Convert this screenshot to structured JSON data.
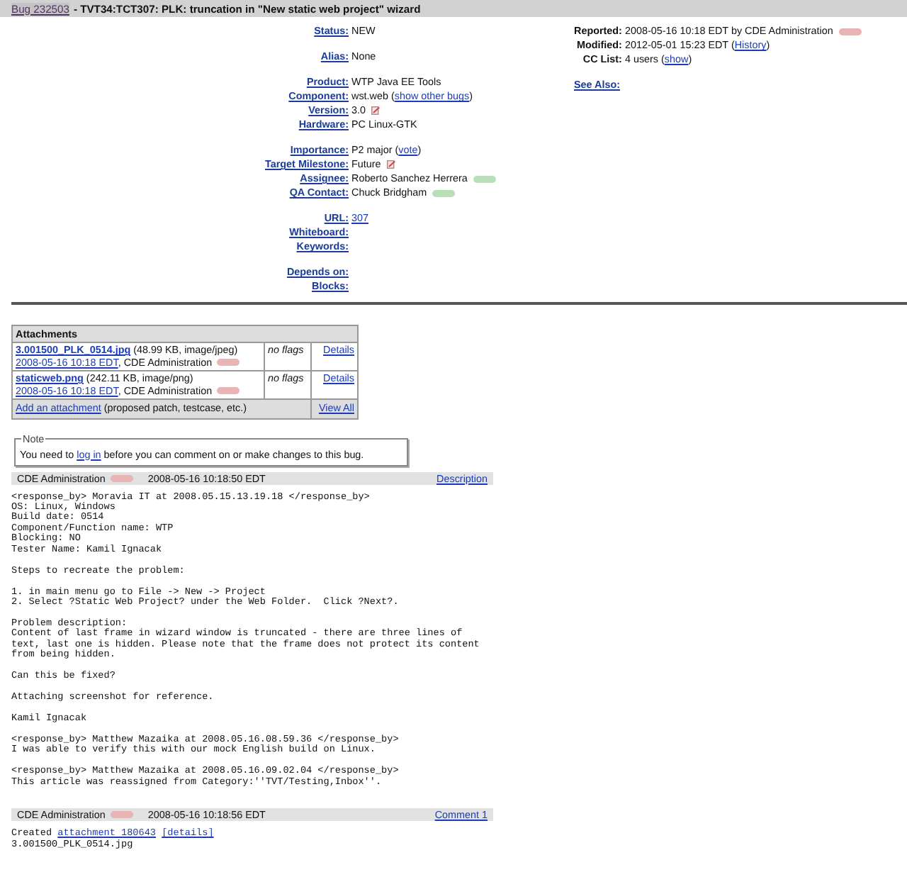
{
  "header": {
    "bug_link": "Bug 232503",
    "title": "- TVT34:TCT307: PLK: truncation in \"New static web project\" wizard"
  },
  "field_groups": [
    [
      {
        "label": "Status:",
        "value": [
          {
            "kind": "text",
            "text": "NEW"
          }
        ]
      }
    ],
    [
      {
        "label": "Alias:",
        "value": [
          {
            "kind": "text",
            "text": "None"
          }
        ]
      }
    ],
    [
      {
        "label": "Product:",
        "value": [
          {
            "kind": "text",
            "text": "WTP Java EE Tools"
          }
        ]
      },
      {
        "label": "Component:",
        "value": [
          {
            "kind": "text",
            "text": "wst.web ("
          },
          {
            "kind": "link",
            "text": "show other bugs"
          },
          {
            "kind": "text",
            "text": ")"
          }
        ]
      },
      {
        "label": "Version:",
        "value": [
          {
            "kind": "text",
            "text": "3.0"
          },
          {
            "kind": "edit"
          }
        ]
      },
      {
        "label": "Hardware:",
        "value": [
          {
            "kind": "text",
            "text": "PC Linux-GTK"
          }
        ]
      }
    ],
    [
      {
        "label": "Importance:",
        "value": [
          {
            "kind": "text",
            "text": "P2 major ("
          },
          {
            "kind": "link",
            "text": "vote"
          },
          {
            "kind": "text",
            "text": ")"
          }
        ]
      },
      {
        "label": "Target Milestone:",
        "value": [
          {
            "kind": "text",
            "text": "Future"
          },
          {
            "kind": "edit"
          }
        ]
      },
      {
        "label": "Assignee:",
        "value": [
          {
            "kind": "text",
            "text": "Roberto Sanchez Herrera"
          },
          {
            "kind": "badge",
            "color": "#b9dfb9"
          }
        ]
      },
      {
        "label": "QA Contact:",
        "value": [
          {
            "kind": "text",
            "text": "Chuck Bridgham"
          },
          {
            "kind": "badge",
            "color": "#b9dfb9"
          }
        ]
      }
    ],
    [
      {
        "label": "URL:",
        "value": [
          {
            "kind": "link",
            "text": "307"
          }
        ]
      },
      {
        "label": "Whiteboard:"
      },
      {
        "label": "Keywords:"
      }
    ],
    [
      {
        "label": "Depends on:"
      },
      {
        "label": "Blocks:"
      }
    ]
  ],
  "people": [
    {
      "label": "Reported:",
      "value": [
        {
          "kind": "text",
          "text": "2008-05-16 10:18 EDT by CDE Administration"
        },
        {
          "kind": "badge",
          "color": "#e8b4b4"
        }
      ]
    },
    {
      "label": "Modified:",
      "value": [
        {
          "kind": "text",
          "text": "2012-05-01 15:23 EDT ("
        },
        {
          "kind": "link",
          "text": "History"
        },
        {
          "kind": "text",
          "text": ")"
        }
      ]
    },
    {
      "label": "CC List:",
      "value": [
        {
          "kind": "text",
          "text": "4 users ("
        },
        {
          "kind": "link",
          "text": "show"
        },
        {
          "kind": "text",
          "text": ")"
        }
      ]
    }
  ],
  "see_also": "See Also:",
  "attachments": {
    "title": "Attachments",
    "rows": [
      {
        "lines": [
          [
            {
              "kind": "file",
              "text": "3.001500_PLK_0514.jpg"
            },
            {
              "kind": "text",
              "text": " (48.99 KB, image/jpeg)"
            }
          ],
          [
            {
              "kind": "link",
              "text": "2008-05-16 10:18 EDT"
            },
            {
              "kind": "text",
              "text": ", CDE Administration"
            },
            {
              "kind": "badge",
              "color": "#e8b4b4"
            }
          ]
        ],
        "flags": "no flags",
        "details": "Details"
      },
      {
        "lines": [
          [
            {
              "kind": "file",
              "text": "staticweb.png"
            },
            {
              "kind": "text",
              "text": " (242.11 KB, image/png)"
            }
          ],
          [
            {
              "kind": "link",
              "text": "2008-05-16 10:18 EDT"
            },
            {
              "kind": "text",
              "text": ", CDE Administration"
            },
            {
              "kind": "badge",
              "color": "#e8b4b4"
            }
          ]
        ],
        "flags": "no flags",
        "details": "Details"
      }
    ],
    "footer": [
      {
        "kind": "link",
        "text": "Add an attachment"
      },
      {
        "kind": "text",
        "text": " (proposed patch, testcase, etc.)"
      }
    ],
    "view_all": "View All"
  },
  "note": {
    "legend": "Note",
    "text": [
      {
        "kind": "text",
        "text": "You need to "
      },
      {
        "kind": "link",
        "text": "log in"
      },
      {
        "kind": "text",
        "text": " before you can comment on or make changes to this bug."
      }
    ]
  },
  "comments": [
    {
      "author": "CDE Administration",
      "badge": {
        "color": "#e8b4b4"
      },
      "time": "2008-05-16 10:18:50 EDT",
      "link": "Description",
      "body": [
        {
          "kind": "text",
          "text": "<response_by> Moravia IT at 2008.05.15.13.19.18 </response_by>\nOS: Linux, Windows\nBuild date: 0514\nComponent/Function name: WTP\nBlocking: NO\nTester Name: Kamil Ignacak\n\nSteps to recreate the problem:\n\n1. in main menu go to File -> New -> Project\n2. Select ?Static Web Project? under the Web Folder.  Click ?Next?.\n\nProblem description:\nContent of last frame in wizard window is truncated - there are three lines of\ntext, last one is hidden. Please note that the frame does not protect its content\nfrom being hidden.\n\nCan this be fixed?\n\nAttaching screenshot for reference.\n\nKamil Ignacak\n\n<response_by> Matthew Mazaika at 2008.05.16.08.59.36 </response_by>\nI was able to verify this with our mock English build on Linux.\n\n<response_by> Matthew Mazaika at 2008.05.16.09.02.04 </response_by>\nThis article was reassigned from Category:''TVT/Testing,Inbox''."
        }
      ]
    },
    {
      "author": "CDE Administration",
      "badge": {
        "color": "#e8b4b4"
      },
      "time": "2008-05-16 10:18:56 EDT",
      "link": "Comment 1",
      "body": [
        {
          "kind": "text",
          "text": "Created "
        },
        {
          "kind": "link",
          "text": "attachment 180643"
        },
        {
          "kind": "link",
          "text": "[details]"
        },
        {
          "kind": "text",
          "text": "\n3.001500_PLK_0514.jpg"
        }
      ]
    }
  ]
}
